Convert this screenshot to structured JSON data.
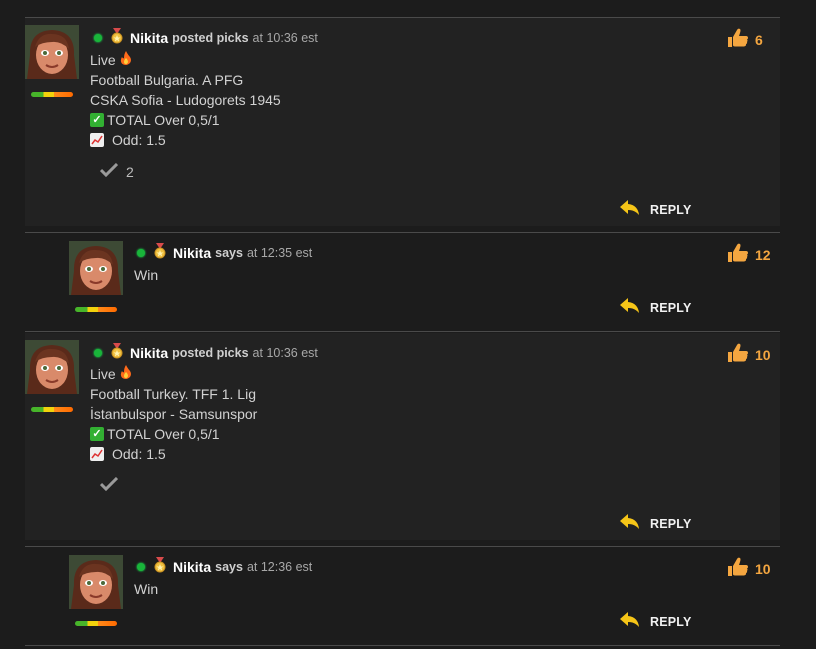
{
  "comments": [
    {
      "username": "Nikita",
      "verb": "posted picks",
      "time": "at 10:36 est",
      "likes": "6",
      "lines": {
        "live": "Live",
        "league": "Football Bulgaria. A PFG",
        "match": "CSKA Sofia - Ludogorets 1945",
        "total": "TOTAL Over 0,5/1",
        "odd": "Odd: 1.5"
      },
      "votes": "2",
      "reply_label": "REPLY"
    },
    {
      "username": "Nikita",
      "verb": "says",
      "time": "at 12:35 est",
      "likes": "12",
      "text": "Win",
      "reply_label": "REPLY"
    },
    {
      "username": "Nikita",
      "verb": "posted picks",
      "time": "at 10:36 est",
      "likes": "10",
      "lines": {
        "live": "Live",
        "league": "Football Turkey. TFF 1. Lig",
        "match": "İstanbulspor - Samsunspor",
        "total": "TOTAL Over 0,5/1",
        "odd": "Odd: 1.5"
      },
      "votes": "",
      "reply_label": "REPLY"
    },
    {
      "username": "Nikita",
      "verb": "says",
      "time": "at 12:36 est",
      "likes": "10",
      "text": "Win",
      "reply_label": "REPLY"
    }
  ],
  "icons": {
    "online": "online-dot",
    "medal": "medal-icon",
    "like": "thumbs-up-icon",
    "fire": "fire-icon",
    "check": "check-mark-icon",
    "chart": "chart-icon",
    "vote": "checkmark-vote-icon",
    "reply": "reply-arrow-icon"
  },
  "colors": {
    "background": "#1c1c1c",
    "card": "#222222",
    "likes": "#f4a640",
    "reply_arrow": "#f5c518",
    "online": "#19b53a"
  }
}
